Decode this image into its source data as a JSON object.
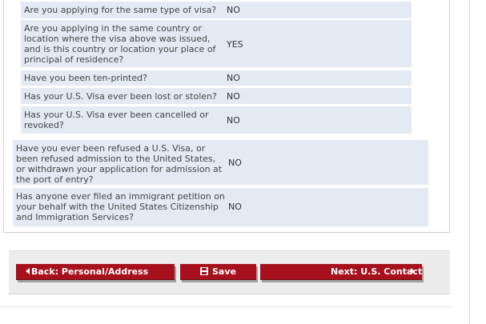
{
  "questions": [
    {
      "q": "Are you applying for the same type of visa?",
      "a": "NO"
    },
    {
      "q": "Are you applying in the same country or location where the visa above was issued, and is this country or location your place of principal of residence?",
      "a": "YES"
    },
    {
      "q": "Have you been ten-printed?",
      "a": "NO"
    },
    {
      "q": "Has your U.S. Visa ever been lost or stolen?",
      "a": "NO"
    },
    {
      "q": "Has your U.S. Visa ever been cancelled or revoked?",
      "a": "NO"
    },
    {
      "q": "Have you ever been refused a U.S. Visa, or been refused admission to the United States, or withdrawn your application for admission at the port of entry?",
      "a": "NO"
    },
    {
      "q": "Has anyone ever filed an immigrant petition on your behalf with the United States Citizenship and Immigration Services?",
      "a": "NO"
    }
  ],
  "buttons": {
    "back": "Back: Personal/Address",
    "save": "Save",
    "next": "Next: U.S. Contact"
  },
  "colors": {
    "button_red": "#a7111d",
    "row_bg": "#e4e9f4"
  },
  "icons": {
    "back": "arrow-left-icon",
    "save": "floppy-disk-icon",
    "next": "arrow-right-icon"
  }
}
